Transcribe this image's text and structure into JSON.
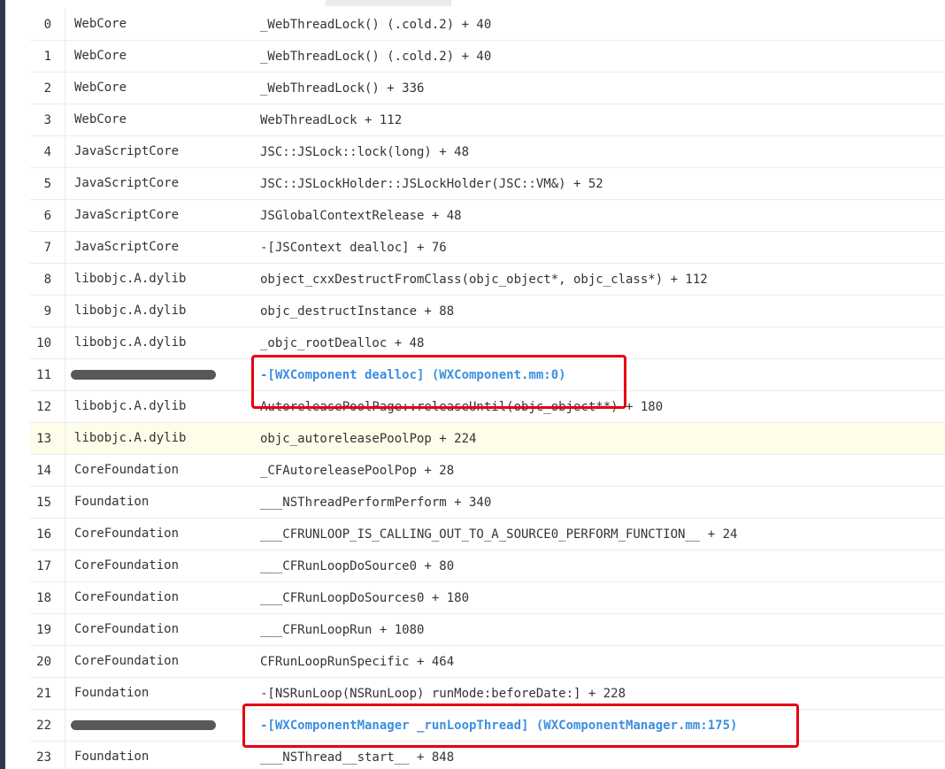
{
  "rows": [
    {
      "index": "0",
      "library": "WebCore",
      "symbol": "_WebThreadLock() (.cold.2) + 40"
    },
    {
      "index": "1",
      "library": "WebCore",
      "symbol": "_WebThreadLock() (.cold.2) + 40"
    },
    {
      "index": "2",
      "library": "WebCore",
      "symbol": "_WebThreadLock() + 336"
    },
    {
      "index": "3",
      "library": "WebCore",
      "symbol": "WebThreadLock + 112"
    },
    {
      "index": "4",
      "library": "JavaScriptCore",
      "symbol": "JSC::JSLock::lock(long) + 48"
    },
    {
      "index": "5",
      "library": "JavaScriptCore",
      "symbol": "JSC::JSLockHolder::JSLockHolder(JSC::VM&) + 52"
    },
    {
      "index": "6",
      "library": "JavaScriptCore",
      "symbol": "JSGlobalContextRelease + 48"
    },
    {
      "index": "7",
      "library": "JavaScriptCore",
      "symbol": "-[JSContext dealloc] + 76"
    },
    {
      "index": "8",
      "library": "libobjc.A.dylib",
      "symbol": "object_cxxDestructFromClass(objc_object*, objc_class*) + 112"
    },
    {
      "index": "9",
      "library": "libobjc.A.dylib",
      "symbol": "objc_destructInstance + 88"
    },
    {
      "index": "10",
      "library": "libobjc.A.dylib",
      "symbol": "_objc_rootDealloc + 48"
    },
    {
      "index": "11",
      "library": "",
      "symbol": "-[WXComponent dealloc] (WXComponent.mm:0)",
      "redacted": true,
      "link": true
    },
    {
      "index": "12",
      "library": "libobjc.A.dylib",
      "symbol": "AutoreleasePoolPage::releaseUntil(objc_object**) + 180"
    },
    {
      "index": "13",
      "library": "libobjc.A.dylib",
      "symbol": "objc_autoreleasePoolPop + 224",
      "highlight": true
    },
    {
      "index": "14",
      "library": "CoreFoundation",
      "symbol": "_CFAutoreleasePoolPop + 28"
    },
    {
      "index": "15",
      "library": "Foundation",
      "symbol": "___NSThreadPerformPerform + 340"
    },
    {
      "index": "16",
      "library": "CoreFoundation",
      "symbol": "___CFRUNLOOP_IS_CALLING_OUT_TO_A_SOURCE0_PERFORM_FUNCTION__ + 24"
    },
    {
      "index": "17",
      "library": "CoreFoundation",
      "symbol": "___CFRunLoopDoSource0 + 80"
    },
    {
      "index": "18",
      "library": "CoreFoundation",
      "symbol": "___CFRunLoopDoSources0 + 180"
    },
    {
      "index": "19",
      "library": "CoreFoundation",
      "symbol": "___CFRunLoopRun + 1080"
    },
    {
      "index": "20",
      "library": "CoreFoundation",
      "symbol": "CFRunLoopRunSpecific + 464"
    },
    {
      "index": "21",
      "library": "Foundation",
      "symbol": "-[NSRunLoop(NSRunLoop) runMode:beforeDate:] + 228"
    },
    {
      "index": "22",
      "library": "",
      "symbol": "-[WXComponentManager _runLoopThread] (WXComponentManager.mm:175)",
      "redacted": true,
      "link": true
    },
    {
      "index": "23",
      "library": "Foundation",
      "symbol": "___NSThread__start__ + 848"
    }
  ],
  "colors": {
    "link": "#3b8fe0",
    "highlight_row": "#fdfdea",
    "annotation_box": "#e60012",
    "sidebar": "#2f3a4e",
    "redaction": "#585858"
  }
}
